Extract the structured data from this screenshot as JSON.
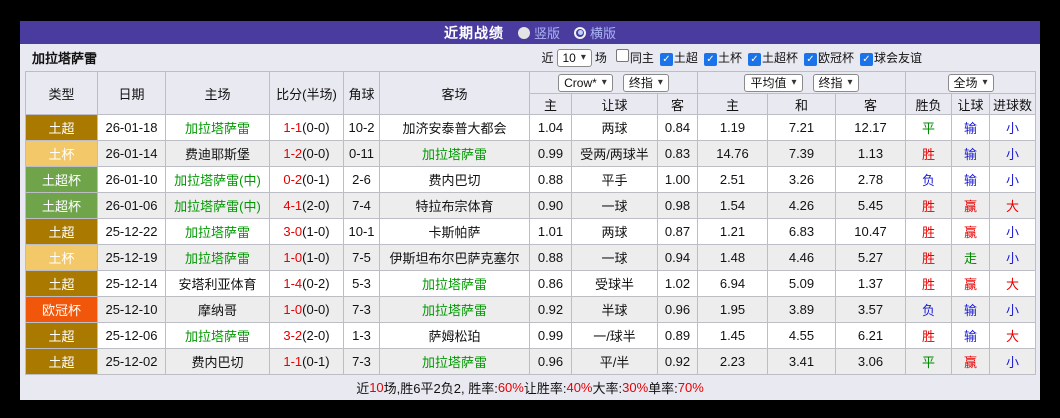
{
  "title_bar": {
    "title": "近期战绩",
    "view_options": [
      {
        "label": "竖版",
        "selected": false
      },
      {
        "label": "横版",
        "selected": true
      }
    ]
  },
  "filter_bar": {
    "team": "加拉塔萨雷",
    "prefix": "近",
    "count": "10",
    "suffix": "场",
    "filters": [
      {
        "label": "同主",
        "checked": false
      },
      {
        "label": "土超",
        "checked": true
      },
      {
        "label": "土杯",
        "checked": true
      },
      {
        "label": "土超杯",
        "checked": true
      },
      {
        "label": "欧冠杯",
        "checked": true
      },
      {
        "label": "球会友谊",
        "checked": true
      }
    ]
  },
  "dropdowns": {
    "asia_source": "Crow*",
    "asia_index": "终指",
    "europe_source": "平均值",
    "europe_index": "终指",
    "scope": "全场"
  },
  "table": {
    "left_headers": [
      "类型",
      "日期",
      "主场",
      "比分(半场)",
      "角球",
      "客场"
    ],
    "sub_headers": [
      "主",
      "让球",
      "客",
      "主",
      "和",
      "客",
      "胜负",
      "让球",
      "进球数"
    ],
    "rows": [
      {
        "type": "土超",
        "date": "26-01-18",
        "home": "加拉塔萨雷",
        "home_color": "team_green",
        "score": "1-1",
        "half": "(0-0)",
        "score_color": "red",
        "corner": "10-2",
        "away": "加济安泰普大都会",
        "away_color": "",
        "crow_home": "1.04",
        "crow_hcp": "两球",
        "crow_away": "0.84",
        "avg_home": "1.19",
        "avg_draw": "7.21",
        "avg_away": "12.17",
        "result": "平",
        "result_color": "green",
        "hcp_result": "输",
        "hcp_color": "blue",
        "goals": "小",
        "goals_color": "blue"
      },
      {
        "type": "土杯",
        "date": "26-01-14",
        "home": "费迪耶斯堡",
        "home_color": "",
        "score": "1-2",
        "half": "(0-0)",
        "score_color": "red",
        "corner": "0-11",
        "away": "加拉塔萨雷",
        "away_color": "team_green",
        "crow_home": "0.99",
        "crow_hcp": "受两/两球半",
        "crow_away": "0.83",
        "avg_home": "14.76",
        "avg_draw": "7.39",
        "avg_away": "1.13",
        "result": "胜",
        "result_color": "red",
        "hcp_result": "输",
        "hcp_color": "blue",
        "goals": "小",
        "goals_color": "blue"
      },
      {
        "type": "土超杯",
        "date": "26-01-10",
        "home": "加拉塔萨雷(中)",
        "home_color": "team_green",
        "score": "0-2",
        "half": "(0-1)",
        "score_color": "red",
        "corner": "2-6",
        "away": "费内巴切",
        "away_color": "",
        "crow_home": "0.88",
        "crow_hcp": "平手",
        "crow_away": "1.00",
        "avg_home": "2.51",
        "avg_draw": "3.26",
        "avg_away": "2.78",
        "result": "负",
        "result_color": "blue",
        "hcp_result": "输",
        "hcp_color": "blue",
        "goals": "小",
        "goals_color": "blue"
      },
      {
        "type": "土超杯",
        "date": "26-01-06",
        "home": "加拉塔萨雷(中)",
        "home_color": "team_green",
        "score": "4-1",
        "half": "(2-0)",
        "score_color": "red",
        "corner": "7-4",
        "away": "特拉布宗体育",
        "away_color": "",
        "crow_home": "0.90",
        "crow_hcp": "一球",
        "crow_away": "0.98",
        "avg_home": "1.54",
        "avg_draw": "4.26",
        "avg_away": "5.45",
        "result": "胜",
        "result_color": "red",
        "hcp_result": "赢",
        "hcp_color": "red",
        "goals": "大",
        "goals_color": "red"
      },
      {
        "type": "土超",
        "date": "25-12-22",
        "home": "加拉塔萨雷",
        "home_color": "team_green",
        "score": "3-0",
        "half": "(1-0)",
        "score_color": "red",
        "corner": "10-1",
        "away": "卡斯帕萨",
        "away_color": "",
        "crow_home": "1.01",
        "crow_hcp": "两球",
        "crow_away": "0.87",
        "avg_home": "1.21",
        "avg_draw": "6.83",
        "avg_away": "10.47",
        "result": "胜",
        "result_color": "red",
        "hcp_result": "赢",
        "hcp_color": "red",
        "goals": "小",
        "goals_color": "blue"
      },
      {
        "type": "土杯",
        "date": "25-12-19",
        "home": "加拉塔萨雷",
        "home_color": "team_green",
        "score": "1-0",
        "half": "(1-0)",
        "score_color": "red",
        "corner": "7-5",
        "away": "伊斯坦布尔巴萨克塞尔",
        "away_color": "",
        "crow_home": "0.88",
        "crow_hcp": "一球",
        "crow_away": "0.94",
        "avg_home": "1.48",
        "avg_draw": "4.46",
        "avg_away": "5.27",
        "result": "胜",
        "result_color": "red",
        "hcp_result": "走",
        "hcp_color": "green",
        "goals": "小",
        "goals_color": "blue"
      },
      {
        "type": "土超",
        "date": "25-12-14",
        "home": "安塔利亚体育",
        "home_color": "",
        "score": "1-4",
        "half": "(0-2)",
        "score_color": "red",
        "corner": "5-3",
        "away": "加拉塔萨雷",
        "away_color": "team_green",
        "crow_home": "0.86",
        "crow_hcp": "受球半",
        "crow_away": "1.02",
        "avg_home": "6.94",
        "avg_draw": "5.09",
        "avg_away": "1.37",
        "result": "胜",
        "result_color": "red",
        "hcp_result": "赢",
        "hcp_color": "red",
        "goals": "大",
        "goals_color": "red"
      },
      {
        "type": "欧冠杯",
        "date": "25-12-10",
        "home": "摩纳哥",
        "home_color": "",
        "score": "1-0",
        "half": "(0-0)",
        "score_color": "red",
        "corner": "7-3",
        "away": "加拉塔萨雷",
        "away_color": "team_green",
        "crow_home": "0.92",
        "crow_hcp": "半球",
        "crow_away": "0.96",
        "avg_home": "1.95",
        "avg_draw": "3.89",
        "avg_away": "3.57",
        "result": "负",
        "result_color": "blue",
        "hcp_result": "输",
        "hcp_color": "blue",
        "goals": "小",
        "goals_color": "blue"
      },
      {
        "type": "土超",
        "date": "25-12-06",
        "home": "加拉塔萨雷",
        "home_color": "team_green",
        "score": "3-2",
        "half": "(2-0)",
        "score_color": "red",
        "corner": "1-3",
        "away": "萨姆松珀",
        "away_color": "",
        "crow_home": "0.99",
        "crow_hcp": "一/球半",
        "crow_away": "0.89",
        "avg_home": "1.45",
        "avg_draw": "4.55",
        "avg_away": "6.21",
        "result": "胜",
        "result_color": "red",
        "hcp_result": "输",
        "hcp_color": "blue",
        "goals": "大",
        "goals_color": "red"
      },
      {
        "type": "土超",
        "date": "25-12-02",
        "home": "费内巴切",
        "home_color": "",
        "score": "1-1",
        "half": "(0-1)",
        "score_color": "red",
        "corner": "7-3",
        "away": "加拉塔萨雷",
        "away_color": "team_green",
        "crow_home": "0.96",
        "crow_hcp": "平/半",
        "crow_away": "0.92",
        "avg_home": "2.23",
        "avg_draw": "3.41",
        "avg_away": "3.06",
        "result": "平",
        "result_color": "green",
        "hcp_result": "赢",
        "hcp_color": "red",
        "goals": "小",
        "goals_color": "blue"
      }
    ]
  },
  "footer": {
    "segments": [
      {
        "text": "近",
        "red": false
      },
      {
        "text": "10",
        "red": true
      },
      {
        "text": "场,胜6平2负2, 胜率:",
        "red": false
      },
      {
        "text": "60%",
        "red": true
      },
      {
        "text": " 让胜率:",
        "red": false
      },
      {
        "text": "40%",
        "red": true
      },
      {
        "text": " 大率:",
        "red": false
      },
      {
        "text": "30%",
        "red": true
      },
      {
        "text": " 单率:",
        "red": false
      },
      {
        "text": "70%",
        "red": true
      }
    ]
  },
  "colors": {
    "accent_purple": "#4a3c9f",
    "red": "#e60000",
    "green": "#008800",
    "blue": "#1c1cd2",
    "team_green": "#009900",
    "type_土超": "#aa7a00",
    "type_土杯": "#f3c869",
    "type_土超杯": "#70a44a",
    "type_欧冠杯": "#f1570a"
  }
}
